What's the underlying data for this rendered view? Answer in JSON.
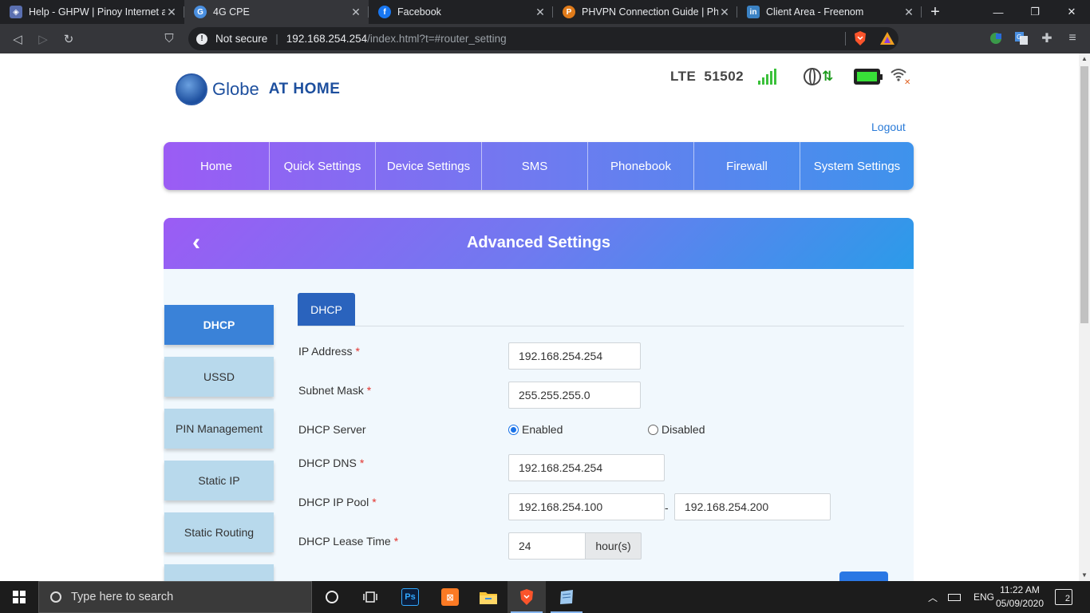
{
  "browser": {
    "tabs": [
      {
        "title": "Help - GHPW | Pinoy Internet and",
        "favicon_color": "#5a6fb0",
        "active": false
      },
      {
        "title": "4G CPE",
        "favicon_color": "#4a8fe0",
        "active": true
      },
      {
        "title": "Facebook",
        "favicon_color": "#1877f2",
        "active": false
      },
      {
        "title": "PHVPN Connection Guide | Philip",
        "favicon_color": "#e07b1a",
        "active": false
      },
      {
        "title": "Client Area - Freenom",
        "favicon_color": "#3b82c4",
        "active": false
      }
    ],
    "close_glyph": "✕",
    "new_tab_glyph": "+",
    "window_controls": {
      "minimize": "—",
      "restore": "❐",
      "close": "✕"
    },
    "nav": {
      "back": "◁",
      "forward": "▷",
      "reload": "↻",
      "bookmark": "⛉"
    },
    "address": {
      "security_label": "Not secure",
      "host": "192.168.254.254",
      "path": "/index.html?t=#router_setting"
    }
  },
  "router": {
    "brand": {
      "name": "Globe",
      "tagline": "AT HOME"
    },
    "status": {
      "network": "LTE",
      "operator_code": "51502",
      "signal_bars": 5,
      "battery_level": 1.0,
      "accent_green": "#38e038"
    },
    "logout_label": "Logout",
    "main_nav": [
      "Home",
      "Quick Settings",
      "Device Settings",
      "SMS",
      "Phonebook",
      "Firewall",
      "System Settings"
    ],
    "page_title": "Advanced Settings",
    "back_glyph": "‹",
    "side_menu": [
      {
        "label": "DHCP",
        "active": true
      },
      {
        "label": "USSD",
        "active": false
      },
      {
        "label": "PIN Management",
        "active": false
      },
      {
        "label": "Static IP",
        "active": false
      },
      {
        "label": "Static Routing",
        "active": false
      }
    ],
    "sub_tab": "DHCP",
    "form": {
      "ip_address": {
        "label": "IP Address",
        "value": "192.168.254.254"
      },
      "subnet_mask": {
        "label": "Subnet Mask",
        "value": "255.255.255.0"
      },
      "dhcp_server": {
        "label": "DHCP Server",
        "options": [
          "Enabled",
          "Disabled"
        ],
        "selected": "Enabled"
      },
      "dhcp_dns": {
        "label": "DHCP DNS",
        "value": "192.168.254.254"
      },
      "dhcp_ip_pool": {
        "label": "DHCP IP Pool",
        "start": "192.168.254.100",
        "end": "192.168.254.200",
        "separator": "-"
      },
      "dhcp_lease_time": {
        "label": "DHCP Lease Time",
        "value": "24",
        "unit": "hour(s)"
      },
      "required_mark": "*"
    },
    "colors": {
      "primary": "#2a63bd",
      "required": "#e3342f",
      "link": "#2a7bd8"
    }
  },
  "taskbar": {
    "search_placeholder": "Type here to search",
    "apps": [
      "task-view",
      "photoshop",
      "xampp",
      "file-explorer",
      "brave",
      "notepad"
    ],
    "language": "ENG",
    "time": "11:22 AM",
    "date": "05/09/2020",
    "notification_count": "2"
  }
}
